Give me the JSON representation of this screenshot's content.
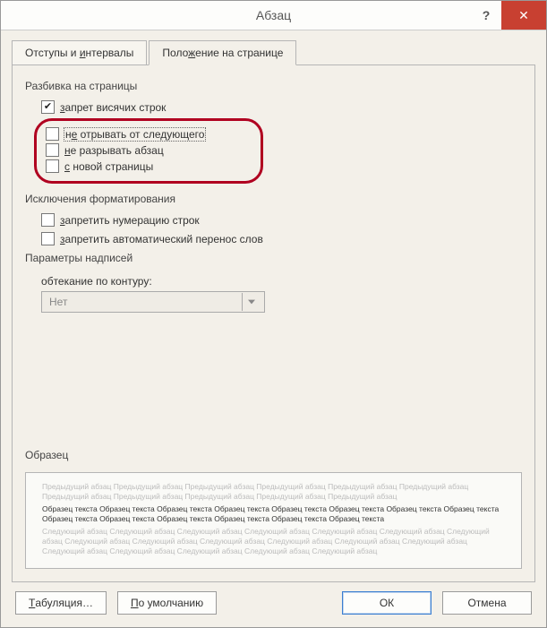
{
  "window": {
    "title": "Абзац",
    "help_symbol": "?",
    "close_symbol": "✕"
  },
  "tabs": {
    "indent": {
      "pre": "Отступы и ",
      "u": "и",
      "post": "нтервалы"
    },
    "position": {
      "pre": "Поло",
      "u": "ж",
      "post": "ение на странице"
    }
  },
  "pagination": {
    "title": "Разбивка на страницы",
    "widow": {
      "u": "з",
      "post": "апрет висячих строк",
      "checked": true
    },
    "keep_next": {
      "pre": "н",
      "u": "е",
      "post": " отрывать от следующего",
      "checked": false,
      "focused": true
    },
    "keep_lines": {
      "u": "н",
      "post": "е разрывать абзац",
      "checked": false
    },
    "page_break": {
      "u": "с",
      "post": " новой страницы",
      "checked": false
    }
  },
  "exceptions": {
    "title": "Исключения форматирования",
    "suppress_numbers": {
      "u": "з",
      "post": "апретить нумерацию строк",
      "checked": false
    },
    "suppress_hyphen": {
      "u": "з",
      "post": "апретить автоматический перенос слов",
      "checked": false
    }
  },
  "textbox": {
    "title": "Параметры надписей",
    "wrap_label": {
      "pre": "о",
      "u": "б",
      "post": "текание по контуру:"
    },
    "wrap_value": "Нет",
    "disabled": true
  },
  "preview": {
    "title": "Образец",
    "prev_line": "Предыдущий абзац Предыдущий абзац Предыдущий абзац Предыдущий абзац Предыдущий абзац Предыдущий абзац Предыдущий абзац Предыдущий абзац Предыдущий абзац Предыдущий абзац Предыдущий абзац",
    "sample_line": "Образец текста Образец текста Образец текста Образец текста Образец текста Образец текста Образец текста Образец текста Образец текста Образец текста Образец текста Образец текста Образец текста Образец текста",
    "next_line": "Следующий абзац Следующий абзац Следующий абзац Следующий абзац Следующий абзац Следующий абзац Следующий абзац Следующий абзац Следующий абзац Следующий абзац Следующий абзац Следующий абзац Следующий абзац Следующий абзац Следующий абзац Следующий абзац Следующий абзац Следующий абзац"
  },
  "buttons": {
    "tabs": {
      "u": "Т",
      "post": "абуляция…"
    },
    "default": {
      "u": "П",
      "post": "о умолчанию"
    },
    "ok": "ОК",
    "cancel": "Отмена"
  }
}
